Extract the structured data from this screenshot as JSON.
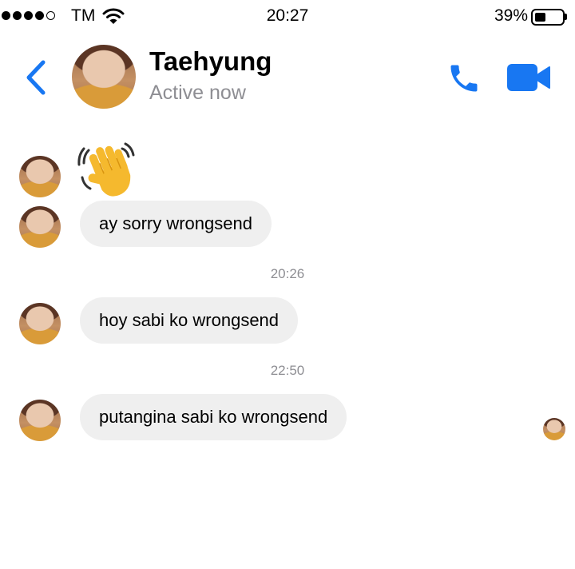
{
  "status_bar": {
    "signal_bars_filled": 4,
    "signal_bars_total": 5,
    "carrier": "TM",
    "time": "20:27",
    "battery_percent": "39%",
    "battery_level": 0.39
  },
  "header": {
    "back_icon": "chevron-left-icon",
    "contact_name": "Taehyung",
    "contact_status": "Active now",
    "call_icon": "phone-icon",
    "video_icon": "video-camera-icon",
    "accent_color": "#1877f2"
  },
  "messages": [
    {
      "type": "emoji",
      "icon": "waving-hand-icon"
    },
    {
      "type": "text",
      "text": "ay sorry wrongsend"
    },
    {
      "type": "timestamp",
      "text": "20:26"
    },
    {
      "type": "text",
      "text": "hoy sabi ko wrongsend"
    },
    {
      "type": "timestamp",
      "text": "22:50"
    },
    {
      "type": "text",
      "text": "putangina sabi ko wrongsend"
    }
  ],
  "seen_indicator": "avatar"
}
